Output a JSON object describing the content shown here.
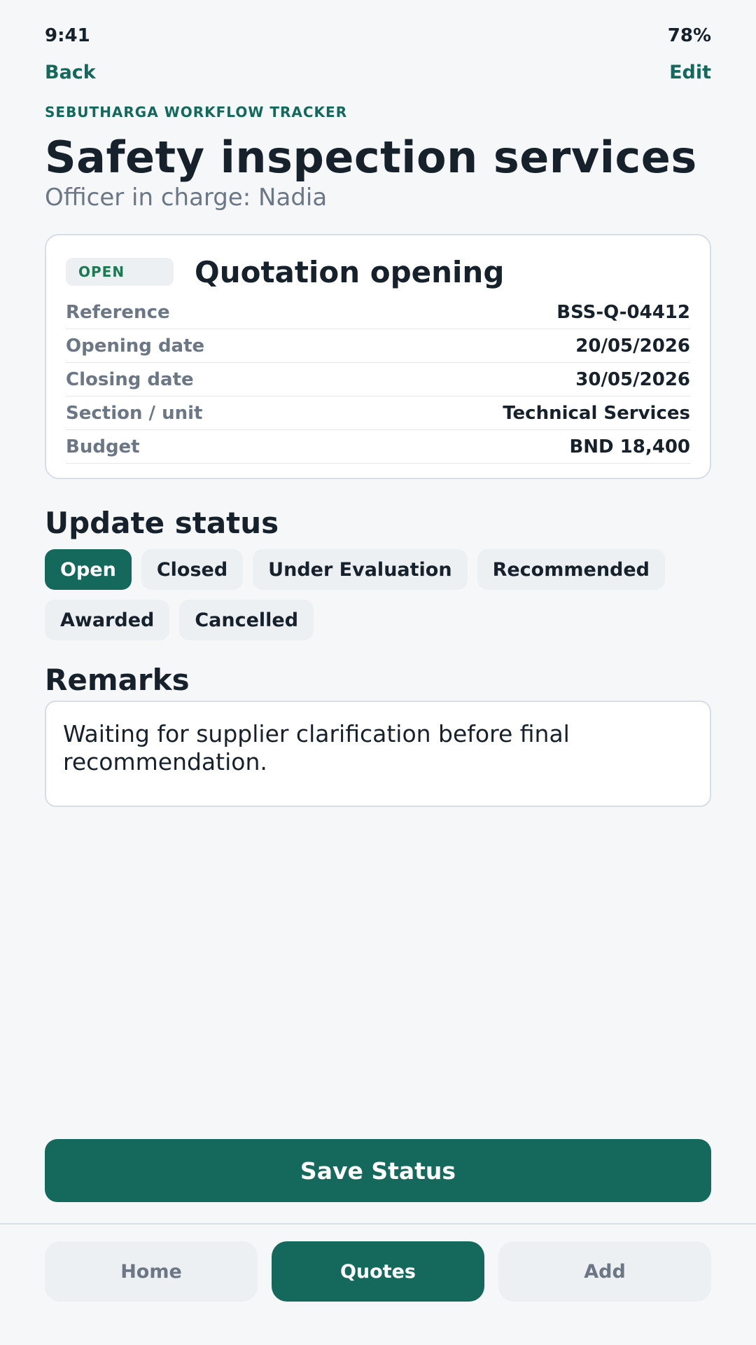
{
  "status_bar": {
    "time": "9:41",
    "battery": "78%"
  },
  "nav": {
    "back_label": "Back",
    "edit_label": "Edit"
  },
  "header": {
    "eyebrow": "SEBUTHARGA WORKFLOW TRACKER",
    "title": "Safety inspection services",
    "subtitle": "Officer in charge: Nadia"
  },
  "card": {
    "badge": "OPEN",
    "title": "Quotation opening",
    "details": [
      {
        "label": "Reference",
        "value": "BSS-Q-04412"
      },
      {
        "label": "Opening date",
        "value": "20/05/2026"
      },
      {
        "label": "Closing date",
        "value": "30/05/2026"
      },
      {
        "label": "Section / unit",
        "value": "Technical Services"
      },
      {
        "label": "Budget",
        "value": "BND 18,400"
      }
    ]
  },
  "update_status": {
    "heading": "Update status",
    "options": [
      "Open",
      "Closed",
      "Under Evaluation",
      "Recommended",
      "Awarded",
      "Cancelled"
    ],
    "selected": "Open"
  },
  "remarks": {
    "heading": "Remarks",
    "text": "Waiting for supplier clarification before final recommendation."
  },
  "save_label": "Save Status",
  "tabs": [
    {
      "label": "Home",
      "active": false
    },
    {
      "label": "Quotes",
      "active": true
    },
    {
      "label": "Add",
      "active": false
    }
  ],
  "colors": {
    "accent": "#14695c",
    "badge_text": "#1b7a52",
    "muted": "#6b7785"
  }
}
